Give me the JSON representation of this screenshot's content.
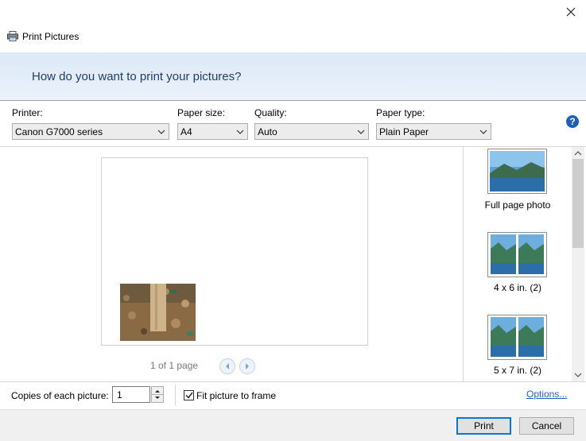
{
  "window": {
    "title": "Print Pictures",
    "close_icon": "close-icon"
  },
  "header": {
    "heading": "How do you want to print your pictures?"
  },
  "settings": {
    "printer": {
      "label": "Printer:",
      "value": "Canon G7000 series"
    },
    "paper_size": {
      "label": "Paper size:",
      "value": "A4"
    },
    "quality": {
      "label": "Quality:",
      "value": "Auto"
    },
    "paper_type": {
      "label": "Paper type:",
      "value": "Plain Paper"
    },
    "help_icon": "help-icon"
  },
  "preview": {
    "page_count": "1 of 1 page"
  },
  "layouts": [
    {
      "label": "Full page photo"
    },
    {
      "label": "4 x 6 in. (2)"
    },
    {
      "label": "5 x 7 in. (2)"
    }
  ],
  "options_bar": {
    "copies_label": "Copies of each picture:",
    "copies_value": "1",
    "fit_label": "Fit picture to frame",
    "fit_checked": true,
    "options_link": "Options..."
  },
  "footer": {
    "print_label": "Print",
    "cancel_label": "Cancel"
  },
  "colors": {
    "accent": "#0078d7",
    "heading": "#1e3d6b",
    "link": "#1e64c8",
    "header_bg": "#dce9f7"
  }
}
